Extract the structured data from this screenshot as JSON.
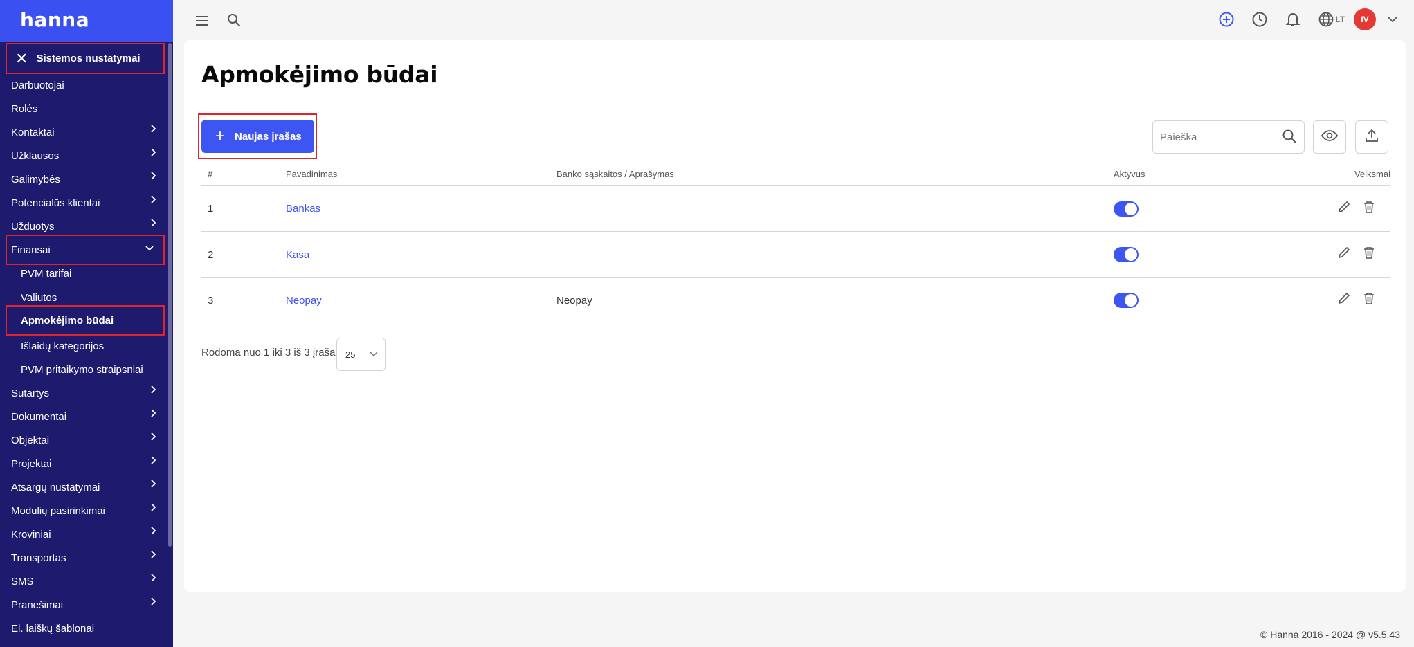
{
  "app": {
    "logo": "hanna"
  },
  "sidebar": {
    "section_title": "Sistemos nustatymai",
    "items": [
      {
        "label": "Darbuotojai",
        "chevron": false
      },
      {
        "label": "Rolės",
        "chevron": false
      },
      {
        "label": "Kontaktai",
        "chevron": true
      },
      {
        "label": "Užklausos",
        "chevron": true
      },
      {
        "label": "Galimybės",
        "chevron": true
      },
      {
        "label": "Potencialūs klientai",
        "chevron": true
      },
      {
        "label": "Užduotys",
        "chevron": true
      },
      {
        "label": "Finansai",
        "chevron": true,
        "expanded": true
      },
      {
        "label": "PVM tarifai",
        "sub": true
      },
      {
        "label": "Valiutos",
        "sub": true
      },
      {
        "label": "Apmokėjimo būdai",
        "sub": true,
        "active": true
      },
      {
        "label": "Išlaidų kategorijos",
        "sub": true
      },
      {
        "label": "PVM pritaikymo straipsniai",
        "sub": true
      },
      {
        "label": "Sutartys",
        "chevron": true
      },
      {
        "label": "Dokumentai",
        "chevron": true
      },
      {
        "label": "Objektai",
        "chevron": true
      },
      {
        "label": "Projektai",
        "chevron": true
      },
      {
        "label": "Atsargų nustatymai",
        "chevron": true
      },
      {
        "label": "Modulių pasirinkimai",
        "chevron": true
      },
      {
        "label": "Kroviniai",
        "chevron": true
      },
      {
        "label": "Transportas",
        "chevron": true
      },
      {
        "label": "SMS",
        "chevron": true
      },
      {
        "label": "Pranešimai",
        "chevron": true
      },
      {
        "label": "El. laiškų šablonai",
        "chevron": false
      }
    ]
  },
  "topbar": {
    "language": "LT",
    "user_initials": "IV",
    "icons": [
      "menu-icon",
      "search-icon",
      "add-circle-icon",
      "clock-icon",
      "bell-icon",
      "globe-icon",
      "chevron-down-icon"
    ]
  },
  "main": {
    "title": "Apmokėjimo būdai",
    "new_button": "Naujas įrašas",
    "search_placeholder": "Paieška",
    "columns": [
      "#",
      "Pavadinimas",
      "Banko sąskaitos / Aprašymas",
      "Aktyvus",
      "Veiksmai"
    ],
    "rows": [
      {
        "num": "1",
        "name": "Bankas",
        "description": "",
        "active": true
      },
      {
        "num": "2",
        "name": "Kasa",
        "description": "",
        "active": true
      },
      {
        "num": "3",
        "name": "Neopay",
        "description": "Neopay",
        "active": true
      }
    ],
    "pager_text": "Rodoma nuo 1 iki 3 iš 3 įrašai",
    "page_size": "25"
  },
  "footer": {
    "text": "© Hanna 2016 - 2024 @ v5.5.43"
  },
  "colors": {
    "sidebar_bg": "#1e1a6e",
    "logo_bg": "#3a50f0",
    "accent": "#3d55f2",
    "highlight_border": "#e0242b",
    "avatar": "#e53935"
  }
}
